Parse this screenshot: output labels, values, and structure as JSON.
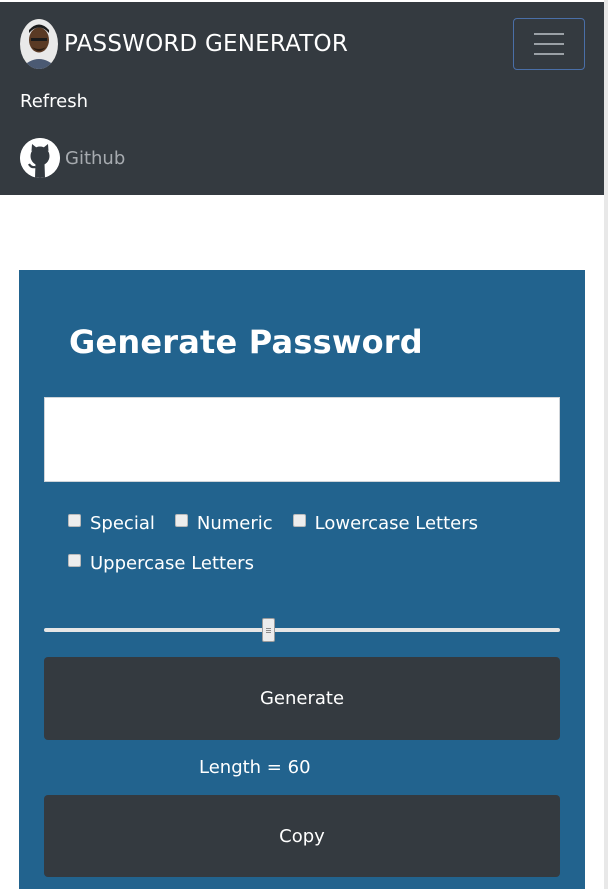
{
  "navbar": {
    "brand_text": "PASSWORD GENERATOR",
    "refresh_label": "Refresh",
    "github_label": "Github",
    "toggler_icon": "hamburger-menu-icon",
    "background": "#343a40"
  },
  "card": {
    "title": "Generate Password",
    "background": "#22638e",
    "password_value": "",
    "options": [
      {
        "label": "Special",
        "checked": false
      },
      {
        "label": "Numeric",
        "checked": false
      },
      {
        "label": "Lowercase Letters",
        "checked": false
      },
      {
        "label": "Uppercase Letters",
        "checked": false
      }
    ],
    "slider": {
      "min": 8,
      "max": 128,
      "value": 60
    },
    "generate_label": "Generate",
    "length_text": "Length = 60",
    "copy_label": "Copy",
    "button_color": "#343a40"
  }
}
